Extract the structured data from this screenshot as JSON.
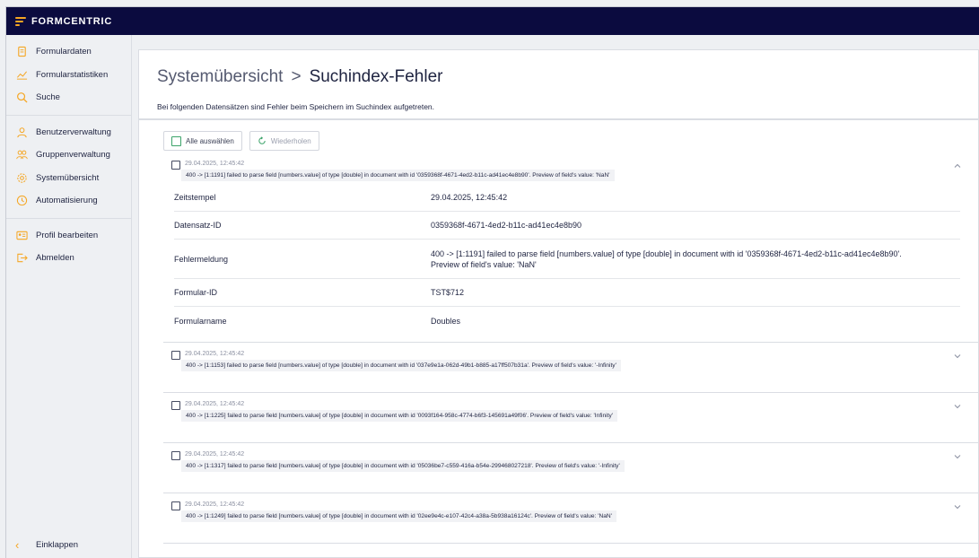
{
  "app": {
    "brand": "FORMCENTRIC"
  },
  "sidebar": {
    "groups": [
      [
        {
          "label": "Formulardaten",
          "icon": "document-icon"
        },
        {
          "label": "Formularstatistiken",
          "icon": "chart-line-icon"
        },
        {
          "label": "Suche",
          "icon": "search-icon"
        }
      ],
      [
        {
          "label": "Benutzerverwaltung",
          "icon": "user-icon"
        },
        {
          "label": "Gruppenverwaltung",
          "icon": "group-icon"
        },
        {
          "label": "Systemübersicht",
          "icon": "gear-icon"
        },
        {
          "label": "Automatisierung",
          "icon": "clock-icon"
        }
      ],
      [
        {
          "label": "Profil bearbeiten",
          "icon": "id-card-icon"
        },
        {
          "label": "Abmelden",
          "icon": "logout-icon"
        }
      ]
    ],
    "collapse_label": "Einklappen"
  },
  "page": {
    "breadcrumb": "Systemübersicht",
    "separator": ">",
    "title": "Suchindex-Fehler",
    "subtitle": "Bei folgenden Datensätzen sind Fehler beim Speichern im Suchindex aufgetreten."
  },
  "toolbar": {
    "select_all": "Alle auswählen",
    "retry": "Wiederholen"
  },
  "details_labels": {
    "timestamp": "Zeitstempel",
    "record_id": "Datensatz-ID",
    "error_message": "Fehlermeldung",
    "form_id": "Formular-ID",
    "form_name": "Formularname"
  },
  "errors": [
    {
      "time": "29.04.2025, 12:45:42",
      "message": "400 -> [1:1191] failed to parse field [numbers.value] of type [double] in document with id '0359368f-4671-4ed2-b11c-ad41ec4e8b90'. Preview of field's value: 'NaN'",
      "expanded": true,
      "details": {
        "timestamp": "29.04.2025, 12:45:42",
        "record_id": "0359368f-4671-4ed2-b11c-ad41ec4e8b90",
        "error_line1": "400 -> [1:1191] failed to parse field [numbers.value] of type [double] in document with id '0359368f-4671-4ed2-b11c-ad41ec4e8b90'.",
        "error_line2": "Preview of field's value: 'NaN'",
        "form_id": "TST$712",
        "form_name": "Doubles"
      }
    },
    {
      "time": "29.04.2025, 12:45:42",
      "message": "400 -> [1:1153] failed to parse field [numbers.value] of type [double] in document with id '037e9e1a-062d-49b1-b885-a17ff507b31a'. Preview of field's value: '-Infinity'",
      "expanded": false
    },
    {
      "time": "29.04.2025, 12:45:42",
      "message": "400 -> [1:1225] failed to parse field [numbers.value] of type [double] in document with id '0093f164-958c-4774-b6f3-145691a49f06'. Preview of field's value: 'Infinity'",
      "expanded": false
    },
    {
      "time": "29.04.2025, 12:45:42",
      "message": "400 -> [1:1317] failed to parse field [numbers.value] of type [double] in document with id '05036be7-c559-416a-b54e-299468027218'. Preview of field's value: '-Infinity'",
      "expanded": false
    },
    {
      "time": "29.04.2025, 12:45:42",
      "message": "400 -> [1:1249] failed to parse field [numbers.value] of type [double] in document with id '02ee9e4c-e107-42c4-a38a-5b938a16124c'. Preview of field's value: 'NaN'",
      "expanded": false
    }
  ],
  "colors": {
    "topbar": "#0b0b3f",
    "accent": "#f5a623",
    "select_green": "#3ca36a"
  }
}
